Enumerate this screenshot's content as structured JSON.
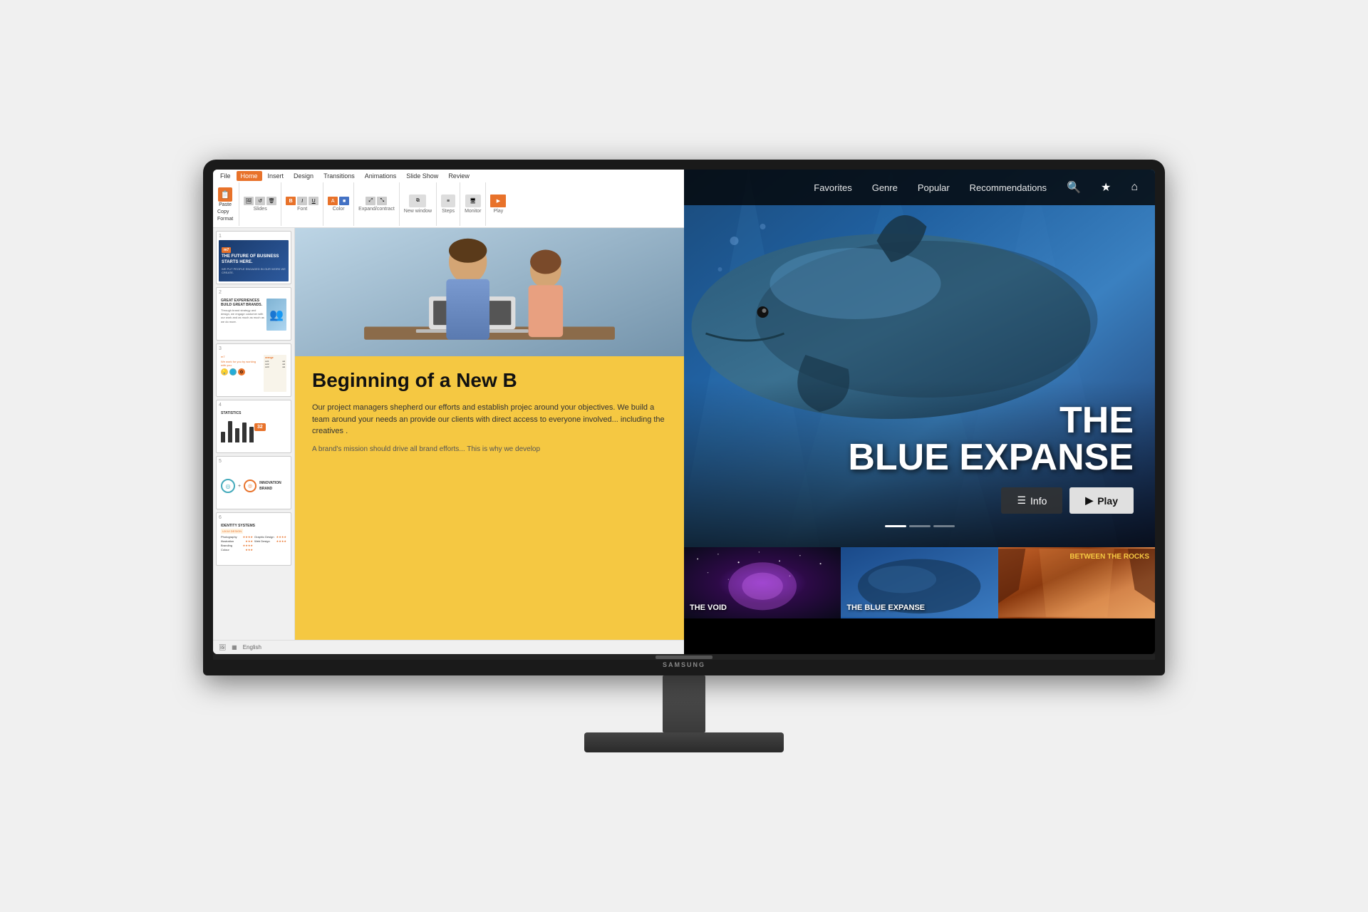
{
  "monitor": {
    "brand": "SAMSUNG"
  },
  "ppt": {
    "tabs": [
      "File",
      "Home",
      "Insert",
      "Design",
      "Transitions",
      "Animations",
      "Slide Show",
      "Review"
    ],
    "active_tab": "Home",
    "ribbon_groups": {
      "clipboard": {
        "paste_label": "Paste",
        "copy_label": "Copy",
        "format_label": "Format"
      },
      "slides": {
        "new_label": "New",
        "reset_label": "Reset",
        "delete_label": "Delete"
      }
    },
    "slides": [
      {
        "num": "1",
        "badge": "m7",
        "title": "THE FUTURE OF BUSINESS STARTS HERE.",
        "subtitle": "WE PUT PEOPLE ENGAGED IN OUR WORK WE CREATE."
      },
      {
        "num": "2",
        "title": "GREAT EXPERIENCES BUILD GREAT BRANDS.",
        "body": "Through brand strategy and design, we engage customer with our work and as much as much as we do more."
      },
      {
        "num": "3",
        "badge": "m7",
        "subtitle": "We work for you by working with you."
      },
      {
        "num": "4",
        "title": "STATISTICS",
        "badge_value": "32"
      },
      {
        "num": "5",
        "label1": "INNOVATION",
        "label2": "BRAND"
      },
      {
        "num": "6",
        "title": "IDENTITY SYSTEMS",
        "subtitle": "UX/UI DESIGN",
        "cols": [
          "Photography",
          "Graphic Design",
          "Illustration",
          "Branding",
          "Colour",
          "Web Design"
        ]
      }
    ],
    "main_slide": {
      "title": "Beginning of a New B",
      "body1": "Our project managers shepherd our efforts and establish projec around your objectives. We build a team around your needs an provide our clients with direct access to everyone involved... including the creatives .",
      "body2": "A brand's mission should drive all brand efforts... This is why we develop"
    },
    "statusbar": {
      "slide_info": "English"
    }
  },
  "streaming": {
    "nav": {
      "favorites": "Favorites",
      "genre": "Genre",
      "popular": "Popular",
      "recommendations": "Recommendations"
    },
    "hero": {
      "title_line1": "THE",
      "title_line2": "BLUE EXPANSE",
      "btn_info": "Info",
      "btn_play": "Play"
    },
    "thumbnails": [
      {
        "id": "the-void",
        "title": "THE VOID",
        "type": "space"
      },
      {
        "id": "blue-expanse",
        "title": "THE BLUE EXPANSE",
        "type": "ocean"
      },
      {
        "id": "between-rocks",
        "title": "BETWEEN THE ROCKS",
        "type": "canyon"
      }
    ]
  }
}
